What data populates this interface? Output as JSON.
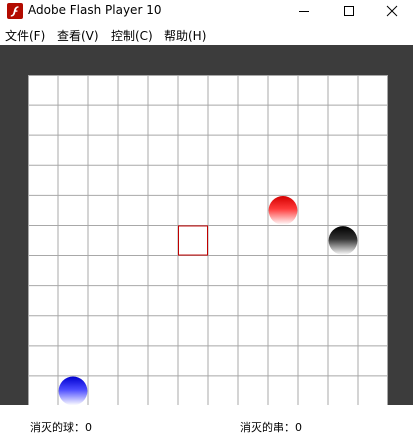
{
  "window": {
    "title": "Adobe Flash Player 10",
    "app_icon": "flash-icon"
  },
  "controls": {
    "minimize": "minimize-icon",
    "maximize": "maximize-icon",
    "close": "close-icon"
  },
  "menu": [
    {
      "label": "文件(F)"
    },
    {
      "label": "查看(V)"
    },
    {
      "label": "控制(C)"
    },
    {
      "label": "帮助(H)"
    }
  ],
  "game": {
    "grid": {
      "columns": 12,
      "rows": 11
    },
    "colors": {
      "background": "#3c3c3c",
      "board": "#ffffff",
      "grid_line": "#a8a8a8",
      "cursor": "#c00000"
    },
    "cursor_cell": {
      "col": 5,
      "row": 5
    },
    "balls": [
      {
        "color": "red",
        "col": 8,
        "row": 4
      },
      {
        "color": "black",
        "col": 10,
        "row": 5
      },
      {
        "color": "blue",
        "col": 1,
        "row": 10
      }
    ]
  },
  "status": {
    "balls_label": "消灭的球：",
    "balls_value": "0",
    "strings_label": "消灭的串：",
    "strings_value": "0"
  }
}
